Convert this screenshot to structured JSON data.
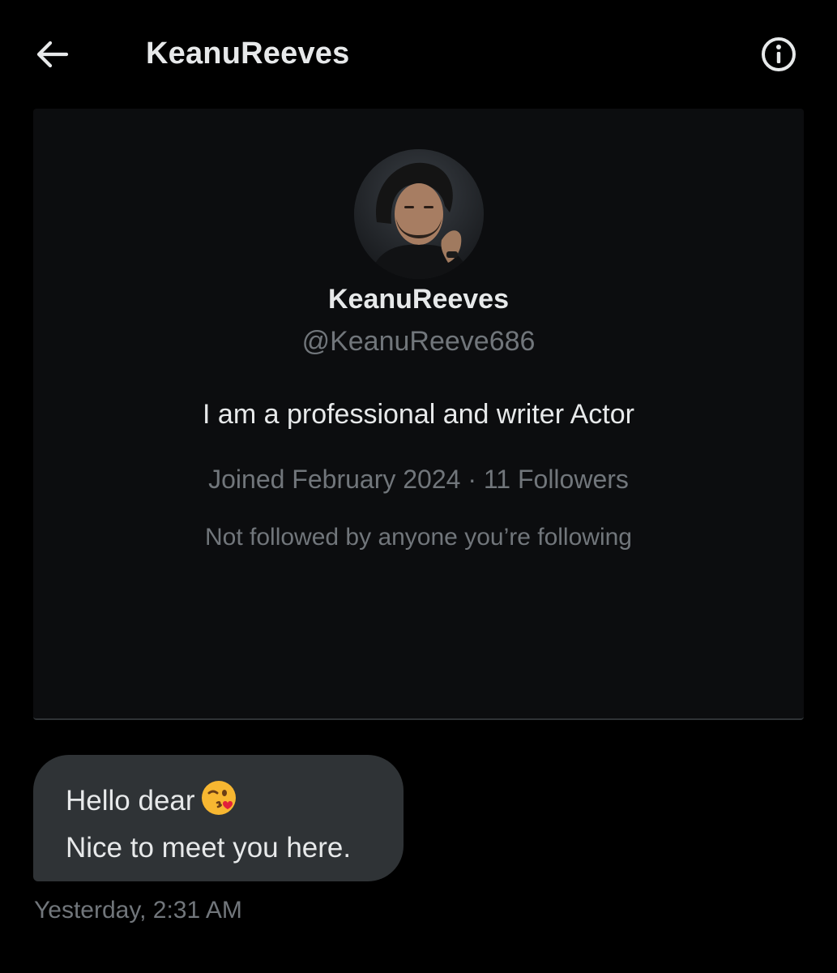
{
  "header": {
    "back_icon": "arrow-left-icon",
    "title": "KeanuReeves",
    "info_icon": "info-icon"
  },
  "profile": {
    "avatar": "avatar-photo",
    "name": "KeanuReeves",
    "handle": "@KeanuReeve686",
    "bio": "I am a professional and writer Actor",
    "meta": "Joined February 2024 · 11 Followers",
    "mutual": "Not followed by anyone you’re following"
  },
  "message": {
    "line1": "Hello dear",
    "emoji": "kissing-winking-face-emoji",
    "line2": "Nice to meet you here.",
    "timestamp": "Yesterday, 2:31 AM"
  },
  "colors": {
    "background": "#000000",
    "card": "#0c0d0f",
    "bubble": "#2f3336",
    "primary_text": "#e7e9ea",
    "secondary_text": "#71767b"
  }
}
